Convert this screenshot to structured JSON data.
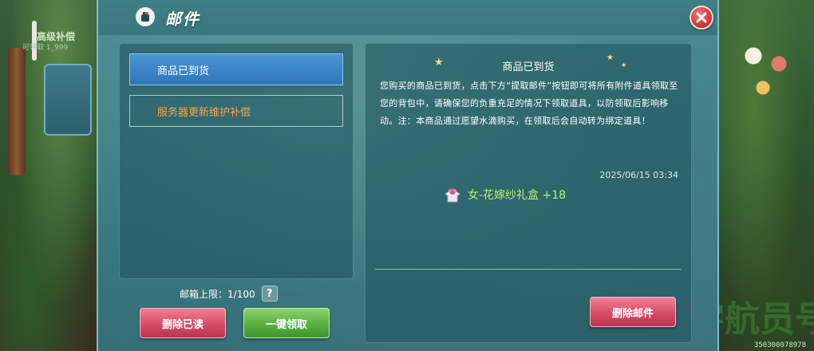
{
  "window": {
    "title": "邮件"
  },
  "background": {
    "sign_text": "高级补偿",
    "sign_subtext": "可领取 1_999",
    "big_text": "宇航员号",
    "serial": "350300078978"
  },
  "mail_list": [
    {
      "subject": "商品已到货",
      "state": "selected"
    },
    {
      "subject": "服务器更新维护补偿",
      "state": "unread"
    }
  ],
  "mailbox": {
    "limit_label": "邮箱上限：",
    "limit_value": "1/100",
    "help_label": "?"
  },
  "buttons": {
    "delete_read": "删除已读",
    "claim_all": "一键领取",
    "delete_mail": "删除邮件"
  },
  "mail_detail": {
    "title": "商品已到货",
    "body": "您购买的商品已到货，点击下方“提取邮件”按钮即可将所有附件道具领取至您的背包中，请确保您的负重充足的情况下领取道具，以防领取后影响移动。注：本商品通过愿望水滴购买，在领取后会自动转为绑定道具！",
    "date": "2025/06/15 03:34",
    "attachment": {
      "name": "女-花嫁纱礼盒",
      "quantity": "+18",
      "icon": "gift-box-icon"
    }
  },
  "colors": {
    "accent_blue": "#2e76b8",
    "unread_orange": "#f0a64c",
    "attachment_green": "#b6f06e",
    "button_red": "#d84c66",
    "button_green": "#58b040"
  }
}
